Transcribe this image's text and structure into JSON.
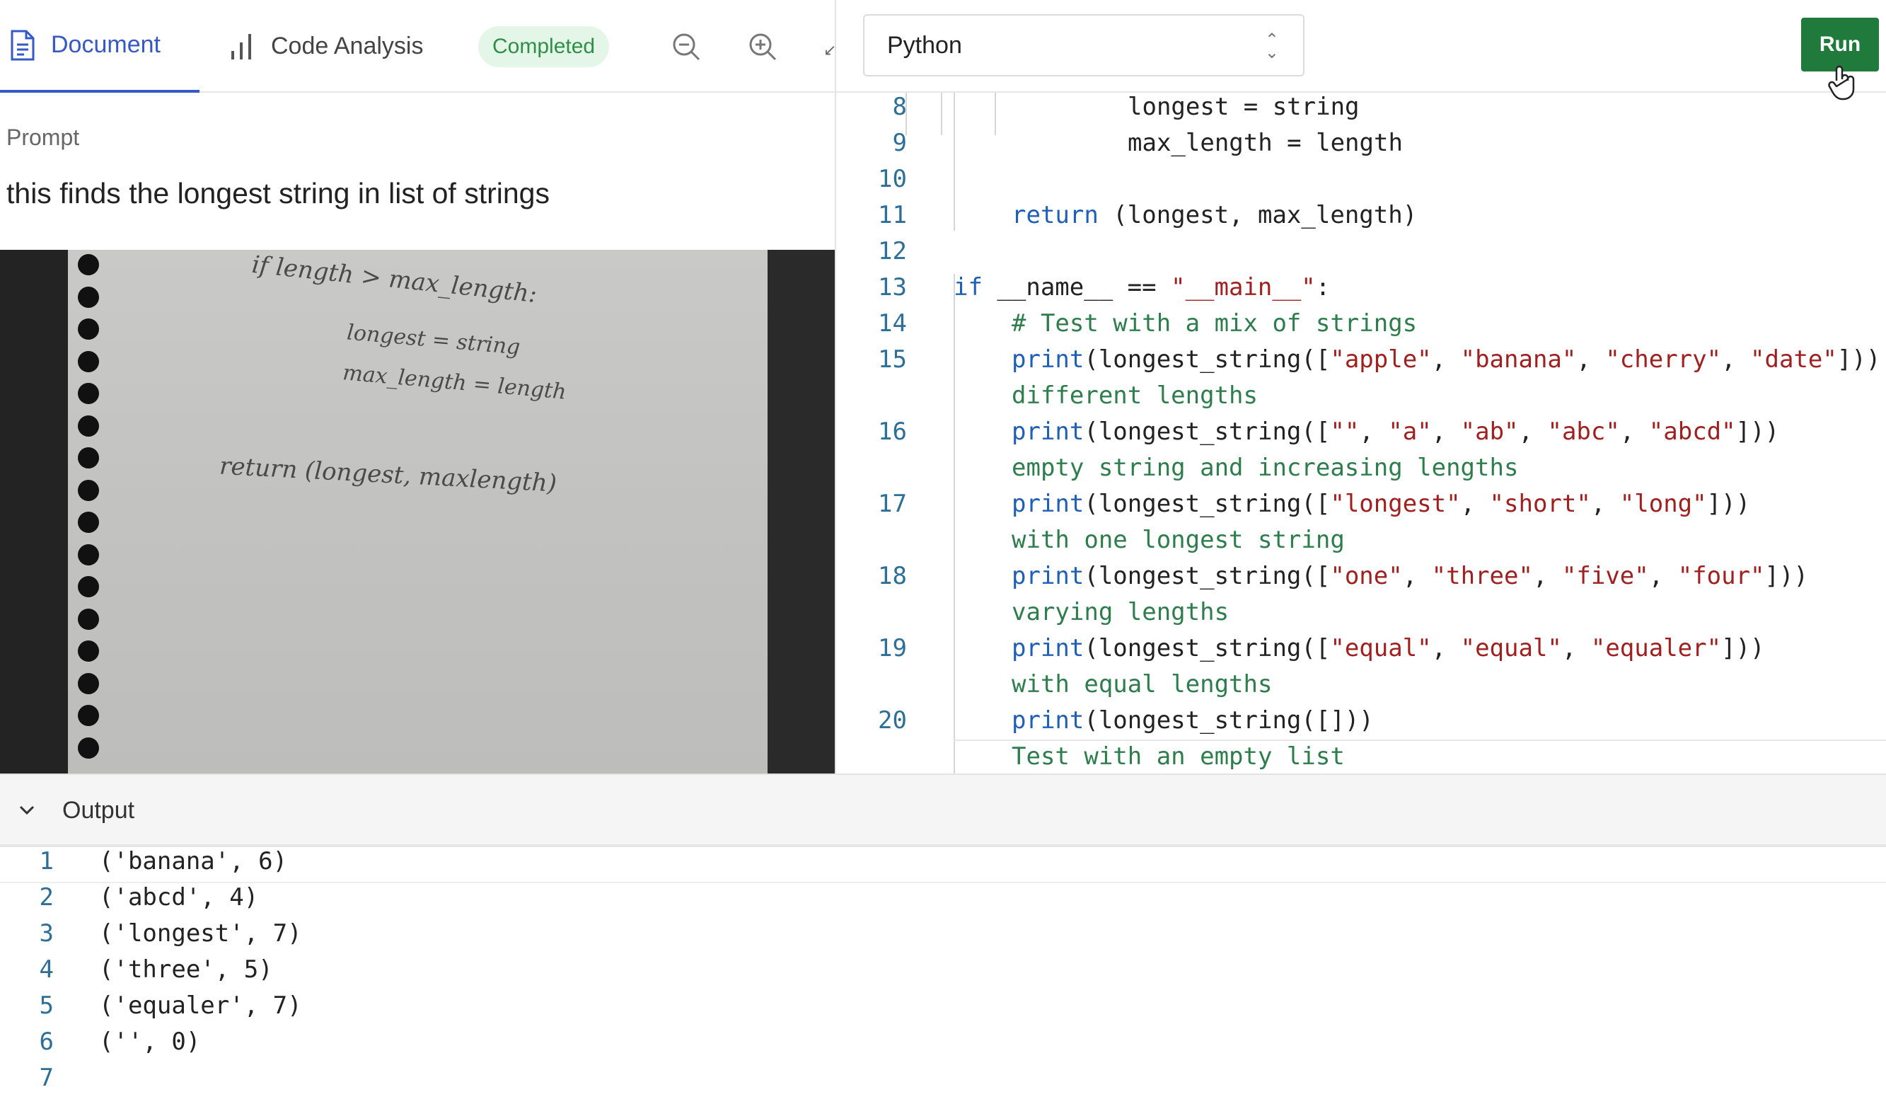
{
  "tabs": {
    "document_label": "Document",
    "code_analysis_label": "Code Analysis",
    "status_badge": "Completed"
  },
  "prompt": {
    "label": "Prompt",
    "text": "this finds the longest string in list of strings"
  },
  "handwritten_note": {
    "line1": "if length > max_length:",
    "line2": "longest = string",
    "line3": "max_length = length",
    "line4": "return (longest, maxlength)"
  },
  "editor": {
    "language": "Python",
    "run_label": "Run",
    "lines": [
      {
        "num": "8",
        "indent": 3,
        "tokens": [
          {
            "t": "longest = string",
            "c": ""
          }
        ]
      },
      {
        "num": "9",
        "indent": 3,
        "tokens": [
          {
            "t": "max_length = length",
            "c": ""
          }
        ]
      },
      {
        "num": "10",
        "indent": 0,
        "tokens": []
      },
      {
        "num": "11",
        "indent": 1,
        "tokens": [
          {
            "t": "return",
            "c": "kw"
          },
          {
            "t": " (longest, max_length)",
            "c": ""
          }
        ]
      },
      {
        "num": "12",
        "indent": 0,
        "tokens": []
      },
      {
        "num": "13",
        "indent": 0,
        "tokens": [
          {
            "t": "if",
            "c": "kw"
          },
          {
            "t": " __name__ == ",
            "c": ""
          },
          {
            "t": "\"__main__\"",
            "c": "str"
          },
          {
            "t": ":",
            "c": ""
          }
        ]
      },
      {
        "num": "14",
        "indent": 1,
        "tokens": [
          {
            "t": "# Test with a mix of strings",
            "c": "cmt"
          }
        ]
      },
      {
        "num": "15",
        "indent": 1,
        "tokens": [
          {
            "t": "print",
            "c": "fn"
          },
          {
            "t": "(longest_string([",
            "c": ""
          },
          {
            "t": "\"apple\"",
            "c": "str"
          },
          {
            "t": ", ",
            "c": ""
          },
          {
            "t": "\"banana\"",
            "c": "str"
          },
          {
            "t": ", ",
            "c": ""
          },
          {
            "t": "\"cherry\"",
            "c": "str"
          },
          {
            "t": ", ",
            "c": ""
          },
          {
            "t": "\"date\"",
            "c": "str"
          },
          {
            "t": "]))",
            "c": ""
          }
        ]
      },
      {
        "num": "",
        "indent": 1,
        "tokens": [
          {
            "t": "different lengths",
            "c": "cmt"
          }
        ]
      },
      {
        "num": "16",
        "indent": 1,
        "tokens": [
          {
            "t": "print",
            "c": "fn"
          },
          {
            "t": "(longest_string([",
            "c": ""
          },
          {
            "t": "\"\"",
            "c": "str"
          },
          {
            "t": ", ",
            "c": ""
          },
          {
            "t": "\"a\"",
            "c": "str"
          },
          {
            "t": ", ",
            "c": ""
          },
          {
            "t": "\"ab\"",
            "c": "str"
          },
          {
            "t": ", ",
            "c": ""
          },
          {
            "t": "\"abc\"",
            "c": "str"
          },
          {
            "t": ", ",
            "c": ""
          },
          {
            "t": "\"abcd\"",
            "c": "str"
          },
          {
            "t": "]))",
            "c": ""
          }
        ]
      },
      {
        "num": "",
        "indent": 1,
        "tokens": [
          {
            "t": "empty string and increasing lengths",
            "c": "cmt"
          }
        ]
      },
      {
        "num": "17",
        "indent": 1,
        "tokens": [
          {
            "t": "print",
            "c": "fn"
          },
          {
            "t": "(longest_string([",
            "c": ""
          },
          {
            "t": "\"longest\"",
            "c": "str"
          },
          {
            "t": ", ",
            "c": ""
          },
          {
            "t": "\"short\"",
            "c": "str"
          },
          {
            "t": ", ",
            "c": ""
          },
          {
            "t": "\"long\"",
            "c": "str"
          },
          {
            "t": "]))",
            "c": ""
          }
        ]
      },
      {
        "num": "",
        "indent": 1,
        "tokens": [
          {
            "t": "with one longest string",
            "c": "cmt"
          }
        ]
      },
      {
        "num": "18",
        "indent": 1,
        "tokens": [
          {
            "t": "print",
            "c": "fn"
          },
          {
            "t": "(longest_string([",
            "c": ""
          },
          {
            "t": "\"one\"",
            "c": "str"
          },
          {
            "t": ", ",
            "c": ""
          },
          {
            "t": "\"three\"",
            "c": "str"
          },
          {
            "t": ", ",
            "c": ""
          },
          {
            "t": "\"five\"",
            "c": "str"
          },
          {
            "t": ", ",
            "c": ""
          },
          {
            "t": "\"four\"",
            "c": "str"
          },
          {
            "t": "]))",
            "c": ""
          }
        ]
      },
      {
        "num": "",
        "indent": 1,
        "tokens": [
          {
            "t": "varying lengths",
            "c": "cmt"
          }
        ]
      },
      {
        "num": "19",
        "indent": 1,
        "tokens": [
          {
            "t": "print",
            "c": "fn"
          },
          {
            "t": "(longest_string([",
            "c": ""
          },
          {
            "t": "\"equal\"",
            "c": "str"
          },
          {
            "t": ", ",
            "c": ""
          },
          {
            "t": "\"equal\"",
            "c": "str"
          },
          {
            "t": ", ",
            "c": ""
          },
          {
            "t": "\"equaler\"",
            "c": "str"
          },
          {
            "t": "]))",
            "c": ""
          }
        ]
      },
      {
        "num": "",
        "indent": 1,
        "tokens": [
          {
            "t": "with equal lengths",
            "c": "cmt"
          }
        ]
      },
      {
        "num": "20",
        "indent": 1,
        "tokens": [
          {
            "t": "print",
            "c": "fn"
          },
          {
            "t": "(longest_string([]))",
            "c": ""
          }
        ]
      },
      {
        "num": "",
        "indent": 1,
        "tokens": [
          {
            "t": "Test with an empty list",
            "c": "cmt"
          }
        ]
      }
    ]
  },
  "output": {
    "title": "Output",
    "lines": [
      {
        "num": "1",
        "text": "('banana', 6)"
      },
      {
        "num": "2",
        "text": "('abcd', 4)"
      },
      {
        "num": "3",
        "text": "('longest', 7)"
      },
      {
        "num": "4",
        "text": "('three', 5)"
      },
      {
        "num": "5",
        "text": "('equaler', 7)"
      },
      {
        "num": "6",
        "text": "('', 0)"
      },
      {
        "num": "7",
        "text": ""
      }
    ]
  },
  "colors": {
    "accent": "#3559c7",
    "run_button": "#1f7a3c",
    "badge_bg": "#e3f6e7",
    "badge_text": "#2f8f46",
    "keyword": "#1f5fb5",
    "string": "#a02020",
    "comment": "#2e7d4d",
    "line_number": "#2e6f98"
  },
  "icons": [
    "document-icon",
    "bar-chart-icon",
    "zoom-out-icon",
    "zoom-in-icon",
    "collapse-icon",
    "select-chevron-icon",
    "hand-cursor-icon",
    "chevron-down-icon"
  ]
}
